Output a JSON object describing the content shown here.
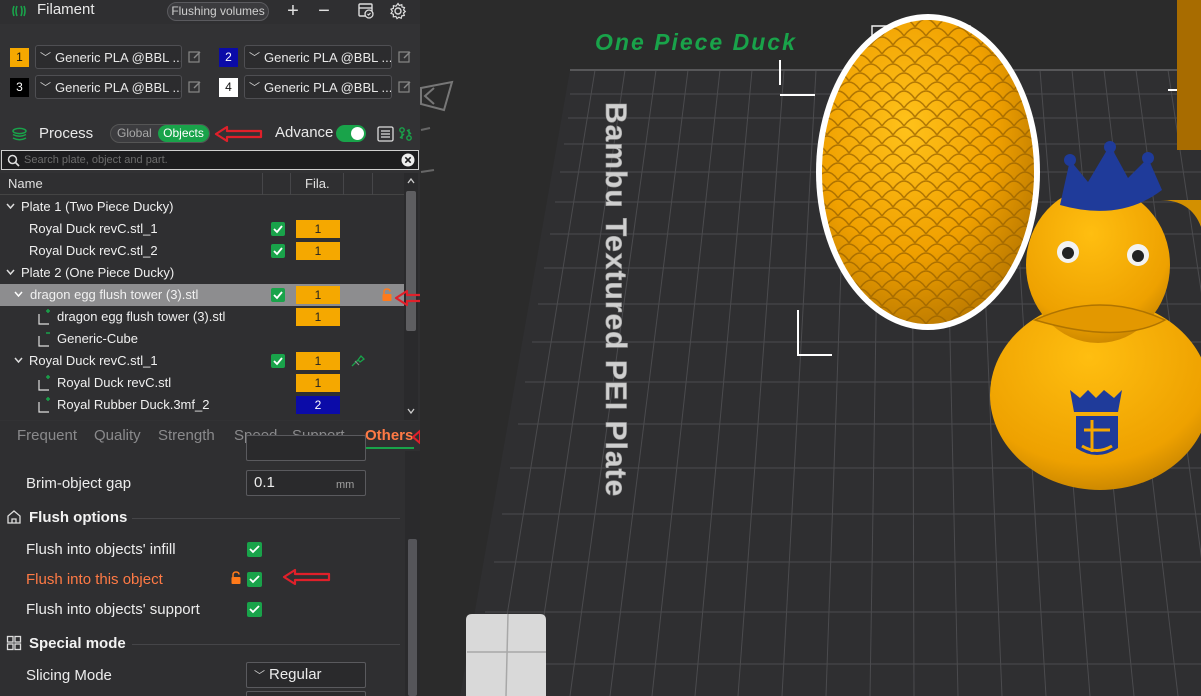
{
  "filament": {
    "title": "Filament",
    "flushing_volumes_label": "Flushing volumes",
    "add_label": "+",
    "remove_label": "−",
    "slots": [
      {
        "num": "1",
        "color": "#f5a800",
        "num_color": "#111111",
        "name": "Generic PLA @BBL ..."
      },
      {
        "num": "2",
        "color": "#0b0ba8",
        "num_color": "#ffffff",
        "name": "Generic PLA @BBL ..."
      },
      {
        "num": "3",
        "color": "#000000",
        "num_color": "#ffffff",
        "name": "Generic PLA @BBL ..."
      },
      {
        "num": "4",
        "color": "#ffffff",
        "num_color": "#111111",
        "name": "Generic PLA @BBL ..."
      }
    ]
  },
  "process": {
    "title": "Process",
    "global_label": "Global",
    "objects_label": "Objects",
    "advance_label": "Advance"
  },
  "search": {
    "placeholder": "Search plate, object and part."
  },
  "object_list": {
    "col_name": "Name",
    "col_fila": "Fila.",
    "rows": [
      {
        "label": "Plate 1 (Two Piece Ducky)"
      },
      {
        "label": "Royal Duck revC.stl_1",
        "fila": "1"
      },
      {
        "label": "Royal Duck revC.stl_2",
        "fila": "1"
      },
      {
        "label": "Plate 2 (One Piece Ducky)"
      },
      {
        "label": "dragon egg flush tower (3).stl",
        "fila": "1"
      },
      {
        "label": "dragon egg flush tower (3).stl",
        "fila": "1"
      },
      {
        "label": "Generic-Cube"
      },
      {
        "label": "Royal Duck revC.stl_1",
        "fila": "1"
      },
      {
        "label": "Royal Duck revC.stl",
        "fila": "1"
      },
      {
        "label": "Royal Rubber Duck.3mf_2",
        "fila": "2"
      }
    ]
  },
  "tabs": [
    "Frequent",
    "Quality",
    "Strength",
    "Speed",
    "Support",
    "Others"
  ],
  "settings": {
    "brim_object_gap_label": "Brim-object gap",
    "brim_object_gap_value": "0.1",
    "brim_object_gap_unit": "mm",
    "flush_section": "Flush options",
    "flush_infill_label": "Flush into objects' infill",
    "flush_this_label": "Flush into this object",
    "flush_support_label": "Flush into objects' support",
    "special_section": "Special mode",
    "slicing_mode_label": "Slicing Mode",
    "slicing_mode_value": "Regular"
  },
  "view": {
    "plate_name": "One Piece Duck",
    "bed_label": "Bambu Textured PEI Plate",
    "bed_color": "#2f2f31",
    "grid_color": "#4b4b4e",
    "model_color": "#f5a800",
    "crown_color": "#1f3b9a"
  },
  "colors": {
    "accent_green": "#19a34a",
    "orange_modified": "#ff7a45",
    "annotation_red": "#e0202a"
  }
}
